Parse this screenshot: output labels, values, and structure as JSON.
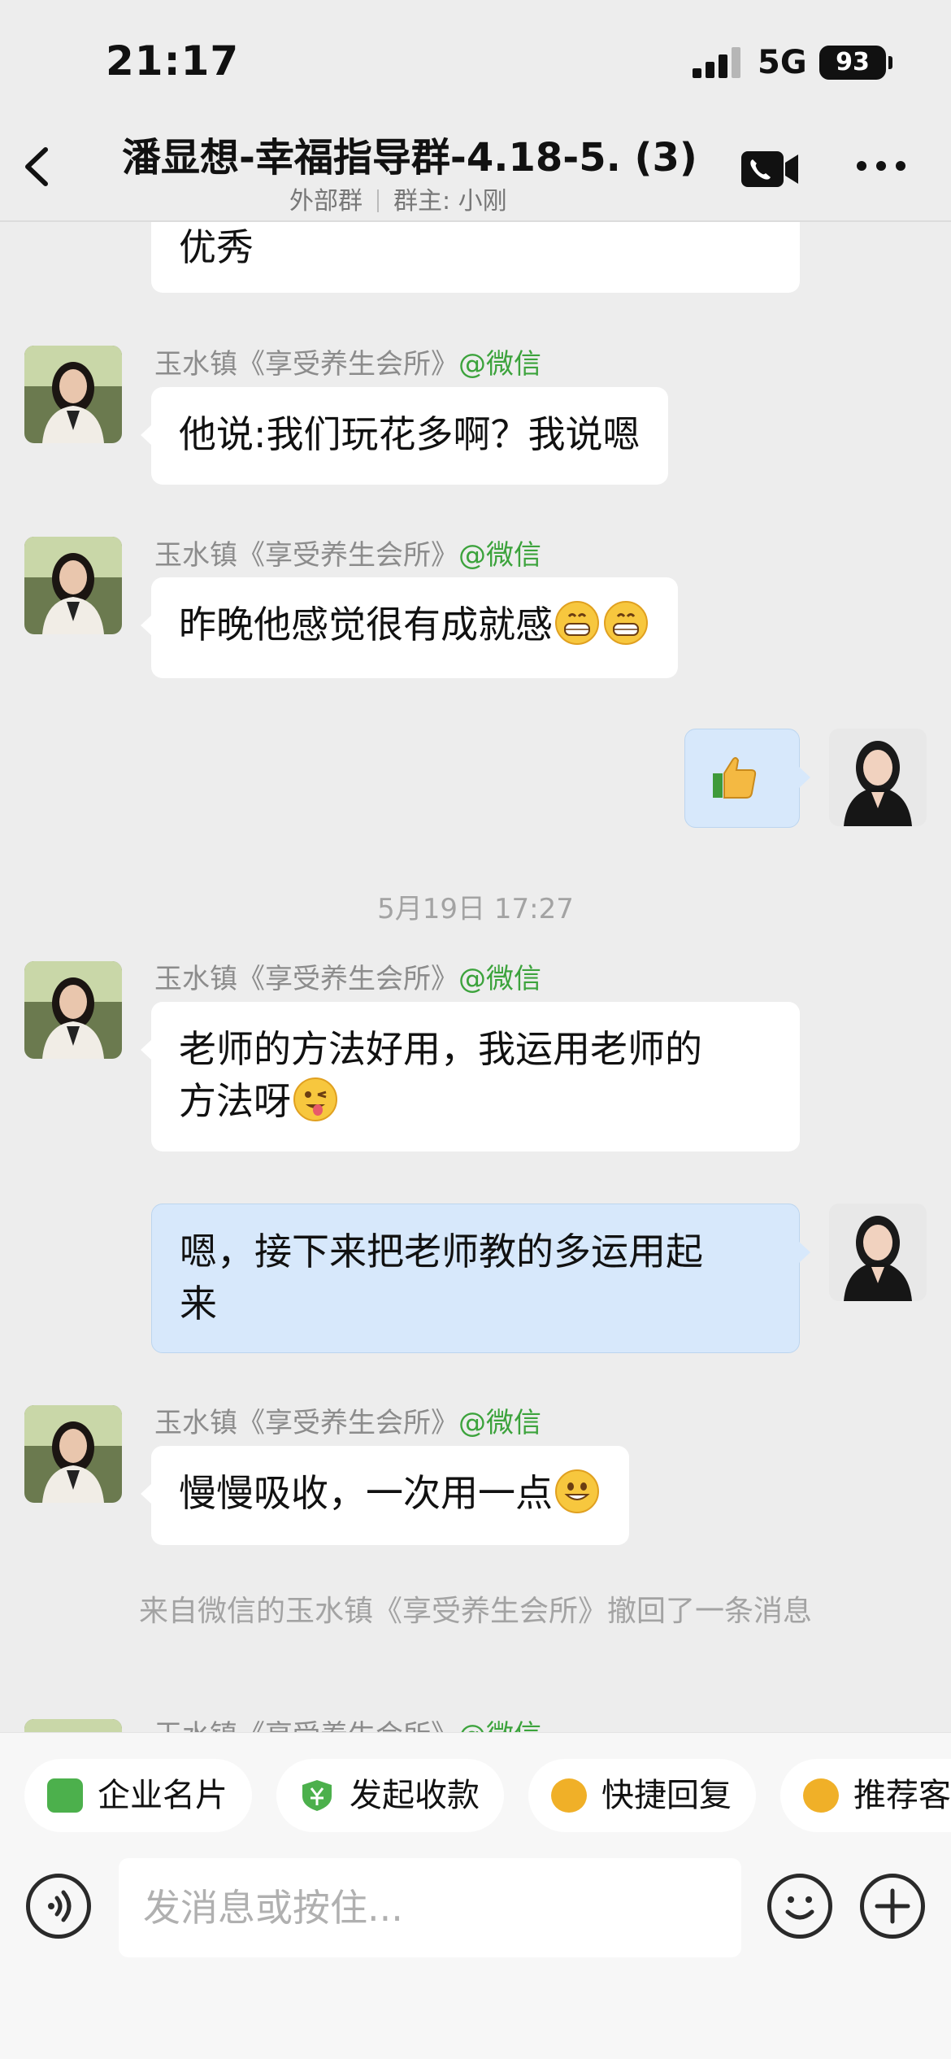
{
  "status_bar": {
    "time": "21:17",
    "network": "5G",
    "battery": "93"
  },
  "header": {
    "title": "潘显想-幸福指导群-4.18-5.  (3)",
    "subtitle_type": "外部群",
    "subtitle_owner": "群主: 小刚"
  },
  "messages": [
    {
      "side": "left",
      "text": "优秀",
      "partial": true
    },
    {
      "side": "left",
      "sender": "玉水镇《享受养生会所》",
      "sender_tag": "@微信",
      "text": "他说:我们玩花多啊？我说嗯"
    },
    {
      "side": "left",
      "sender": "玉水镇《享受养生会所》",
      "sender_tag": "@微信",
      "text": "昨晚他感觉很有成就感",
      "emoji": [
        "grin-emoji",
        "grin-emoji"
      ]
    },
    {
      "side": "right",
      "emoji": [
        "thumbs-up-emoji"
      ]
    },
    {
      "timestamp": "5月19日 17:27"
    },
    {
      "side": "left",
      "sender": "玉水镇《享受养生会所》",
      "sender_tag": "@微信",
      "text_line1": "老师的方法好用，我运用老师的",
      "text_line2": "方法呀",
      "emoji": [
        "wink-tongue-emoji"
      ]
    },
    {
      "side": "right",
      "text_line1": "嗯，接下来把老师教的多运用起",
      "text_line2": "来"
    },
    {
      "side": "left",
      "sender": "玉水镇《享受养生会所》",
      "sender_tag": "@微信",
      "text": "慢慢吸收，一次用一点",
      "emoji": [
        "smile-emoji"
      ]
    },
    {
      "system": "来自微信的玉水镇《享受养生会所》撤回了一条消息"
    },
    {
      "side": "left",
      "sender": "玉水镇《享受养生会所》",
      "sender_tag": "@微信",
      "partial": true
    }
  ],
  "quick_actions": [
    {
      "label": "企业名片",
      "icon": "card-icon",
      "color": "#4cb04c"
    },
    {
      "label": "发起收款",
      "icon": "yuan-shield-icon",
      "color": "#4cb04c"
    },
    {
      "label": "快捷回复",
      "icon": "quick-reply-icon",
      "color": "#f0b028"
    },
    {
      "label": "推荐客",
      "icon": "recommend-icon",
      "color": "#f0b028"
    }
  ],
  "composer": {
    "placeholder": "发消息或按住..."
  },
  "colors": {
    "background": "#ededed",
    "my_bubble": "#d7e8fb",
    "sender_tag": "#3ca33c"
  }
}
